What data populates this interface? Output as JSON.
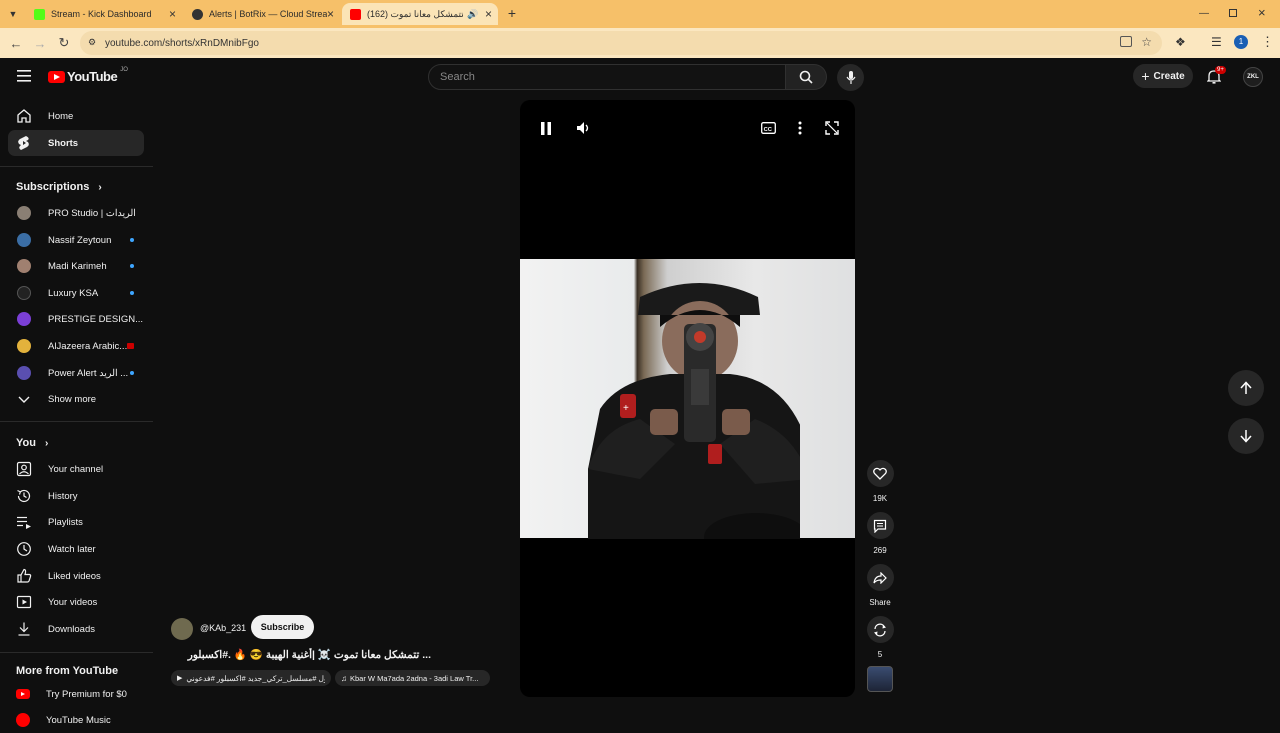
{
  "browser": {
    "tabs": [
      {
        "label": "Stream - Kick Dashboard",
        "favicon_color": "#53fc18"
      },
      {
        "label": "Alerts | BotRix — Cloud Stream",
        "favicon_color": "#333333"
      },
      {
        "label": "(162) تتمشكل معانا تموت ...",
        "favicon_color": "#ff0000",
        "active": true
      }
    ],
    "url": "youtube.com/shorts/xRnDMnibFgo",
    "profile_initial": "1",
    "icons": [
      "back-arrow-icon",
      "forward-arrow-icon",
      "reload-icon",
      "site-info-icon",
      "install-app-icon",
      "bookmark-star-icon",
      "extensions-icon",
      "media-controls-icon",
      "menu-dots-icon"
    ]
  },
  "youtube": {
    "logo_text": "YouTube",
    "country": "JO",
    "search_placeholder": "Search",
    "create_label": "Create",
    "notif_count": "9+",
    "avatar_text": "ZKL"
  },
  "sidebar": {
    "main": [
      {
        "label": "Home",
        "icon": "home-icon"
      },
      {
        "label": "Shorts",
        "icon": "shorts-icon",
        "active": true
      }
    ],
    "subscriptions_title": "Subscriptions",
    "subscriptions": [
      {
        "label": "PRO Studio | الريدات",
        "color": "#8a7f74",
        "new": false
      },
      {
        "label": "Nassif Zeytoun",
        "color": "#3b6ea5",
        "new": true
      },
      {
        "label": "Madi Karimeh",
        "color": "#a08070",
        "new": true
      },
      {
        "label": "Luxury KSA",
        "color": "#222222",
        "new": true
      },
      {
        "label": "PRESTIGE DESIGN...",
        "color": "#7b3fd6",
        "new": false
      },
      {
        "label": "AlJazeera Arabic...",
        "color": "#e3b23c",
        "new": false,
        "live": true
      },
      {
        "label": "Power Alert الريد ...",
        "color": "#5a4fb0",
        "new": true
      }
    ],
    "show_more": "Show more",
    "you_title": "You",
    "you": [
      {
        "label": "Your channel",
        "icon": "channel-icon"
      },
      {
        "label": "History",
        "icon": "history-icon"
      },
      {
        "label": "Playlists",
        "icon": "playlists-icon"
      },
      {
        "label": "Watch later",
        "icon": "watch-later-icon"
      },
      {
        "label": "Liked videos",
        "icon": "like-icon"
      },
      {
        "label": "Your videos",
        "icon": "your-videos-icon"
      },
      {
        "label": "Downloads",
        "icon": "download-icon"
      }
    ],
    "more_title": "More from YouTube",
    "more": [
      {
        "label": "Try Premium for $0",
        "icon": "youtube-premium-icon"
      },
      {
        "label": "YouTube Music",
        "icon": "youtube-music-icon"
      }
    ]
  },
  "short": {
    "channel": "@KAb_231",
    "subscribe": "Subscribe",
    "title": "... تتمشكل معانا تموت ☠️ |أغنية الهيبة 😎 🔥 .#اكسبلور",
    "chips": [
      "الاول #مسلسل_تركي_جديد #اكسبلور #فدعوني ...",
      "Kbar W Ma7ada 2adna - 3adi Law Tr..."
    ],
    "likes": "19K",
    "comments": "269",
    "share": "Share",
    "remix": "5"
  },
  "colors": {
    "accent": "#ff0000",
    "bg": "#0f0f0f",
    "chrome": "#f6c069",
    "blue": "#3ea6ff"
  }
}
